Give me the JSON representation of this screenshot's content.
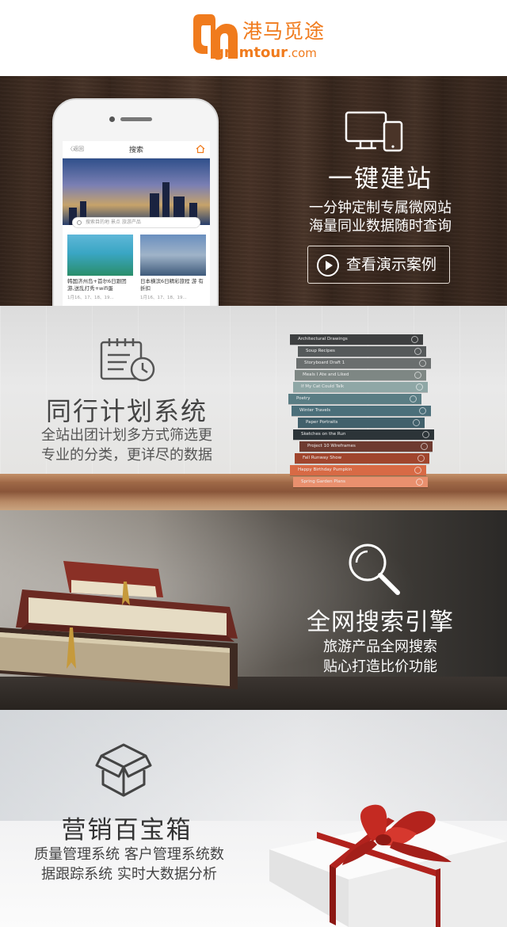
{
  "header": {
    "brand_cn": "港马觅途",
    "brand_en": "gmmtour",
    "brand_domain": ".com",
    "brand_color": "#f07b1d"
  },
  "section1": {
    "icon": "devices-icon",
    "title": "一键建站",
    "subtitle_line1": "一分钟定制专属微网站",
    "subtitle_line2": "海量同业数据随时查询",
    "button_label": "查看演示案例",
    "phone": {
      "back_label": "〈返回",
      "screen_title": "搜索",
      "search_placeholder": "搜索目的地  景点  旅游产品",
      "cards": [
        {
          "title": "韩国济州岛+首尔6日跟团游,送乱打秀+wifi蛋",
          "meta": "1月16、17、18、19..."
        },
        {
          "title": "日本横滨6日精彩旅程 游 有折扣",
          "meta": "1月16、17、18、19..."
        }
      ]
    }
  },
  "section2": {
    "icon": "calendar-clock-icon",
    "title": "同行计划系统",
    "subtitle_line1": "全站出团计划多方式筛选更",
    "subtitle_line2": "专业的分类，更详尽的数据",
    "books": [
      {
        "label": "Architectural Drawings",
        "color": "#3d3f40"
      },
      {
        "label": "Soup Recipes",
        "color": "#55595a"
      },
      {
        "label": "Storyboard Draft 1",
        "color": "#6a6e6e"
      },
      {
        "label": "Meals I Ate and Liked",
        "color": "#7e8784"
      },
      {
        "label": "If My Cat Could Talk",
        "color": "#8fa7a6"
      },
      {
        "label": "Poetry",
        "color": "#5a7d84"
      },
      {
        "label": "Winter Travels",
        "color": "#4b6f7a"
      },
      {
        "label": "Paper Portraits",
        "color": "#41606b"
      },
      {
        "label": "Sketches on the Run",
        "color": "#2c3438"
      },
      {
        "label": "Project 10 Wireframes",
        "color": "#6e3b30"
      },
      {
        "label": "Fall Runway Show",
        "color": "#a0452d"
      },
      {
        "label": "Happy Birthday Pumpkin",
        "color": "#d86a45"
      },
      {
        "label": "Spring Garden Plans",
        "color": "#e9906e"
      }
    ]
  },
  "section3": {
    "icon": "search-icon",
    "title": "全网搜索引擎",
    "subtitle_line1": "旅游产品全网搜索",
    "subtitle_line2": "贴心打造比价功能"
  },
  "section4": {
    "icon": "box-icon",
    "title": "营销百宝箱",
    "subtitle_line1": "质量管理系统 客户管理系统数",
    "subtitle_line2": "据跟踪系统 实时大数据分析"
  }
}
